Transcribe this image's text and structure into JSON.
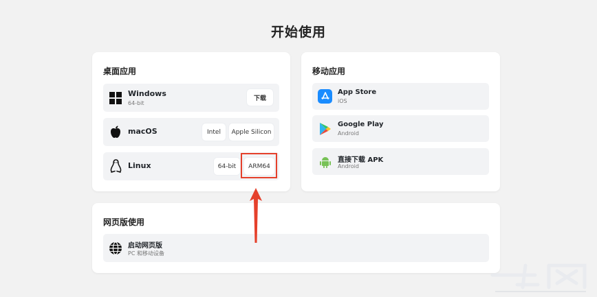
{
  "page": {
    "title": "开始使用"
  },
  "desktop": {
    "title": "桌面应用",
    "items": [
      {
        "name": "Windows",
        "sub": "64-bit",
        "buttons": [
          "下载"
        ]
      },
      {
        "name": "macOS",
        "buttons": [
          "Intel",
          "Apple Silicon"
        ]
      },
      {
        "name": "Linux",
        "buttons": [
          "64-bit",
          "ARM64"
        ]
      }
    ]
  },
  "mobile": {
    "title": "移动应用",
    "items": [
      {
        "name": "App Store",
        "sub": "iOS"
      },
      {
        "name": "Google Play",
        "sub": "Android"
      },
      {
        "name": "直接下载 APK",
        "sub": "Android"
      }
    ]
  },
  "web": {
    "title": "网页版使用",
    "item": {
      "name": "启动网页版",
      "sub": "PC 和移动设备"
    }
  },
  "colors": {
    "highlight": "#e5402b",
    "appstore": "#1a8cff",
    "android": "#78c257"
  }
}
